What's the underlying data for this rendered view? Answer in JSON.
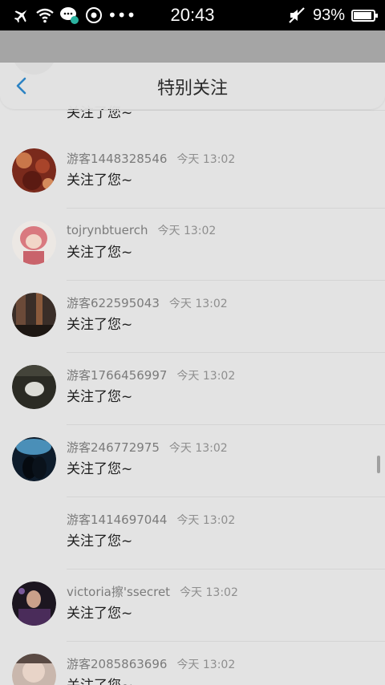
{
  "status_bar": {
    "time": "20:43",
    "battery": "93%",
    "icons": [
      "airplane-icon",
      "wifi-icon",
      "chat-notification-icon",
      "media-icon",
      "more-dots-icon",
      "mute-icon",
      "battery-icon"
    ]
  },
  "header": {
    "title": "特别关注"
  },
  "partial_top_row": {
    "msg": "关注了您~"
  },
  "rows": [
    {
      "name": "游客1448328546",
      "time": "今天 13:02",
      "msg": "关注了您~"
    },
    {
      "name": "tojrynbtuerch",
      "time": "今天 13:02",
      "msg": "关注了您~"
    },
    {
      "name": "游客622595043",
      "time": "今天 13:02",
      "msg": "关注了您~"
    },
    {
      "name": "游客1766456997",
      "time": "今天 13:02",
      "msg": "关注了您~"
    },
    {
      "name": "游客246772975",
      "time": "今天 13:02",
      "msg": "关注了您~"
    },
    {
      "name": "游客1414697044",
      "time": "今天 13:02",
      "msg": "关注了您~"
    },
    {
      "name": "victoria擦'ssecret",
      "time": "今天 13:02",
      "msg": "关注了您~"
    },
    {
      "name": "游客2085863696",
      "time": "今天 13:02",
      "msg": "关注了您~"
    }
  ]
}
